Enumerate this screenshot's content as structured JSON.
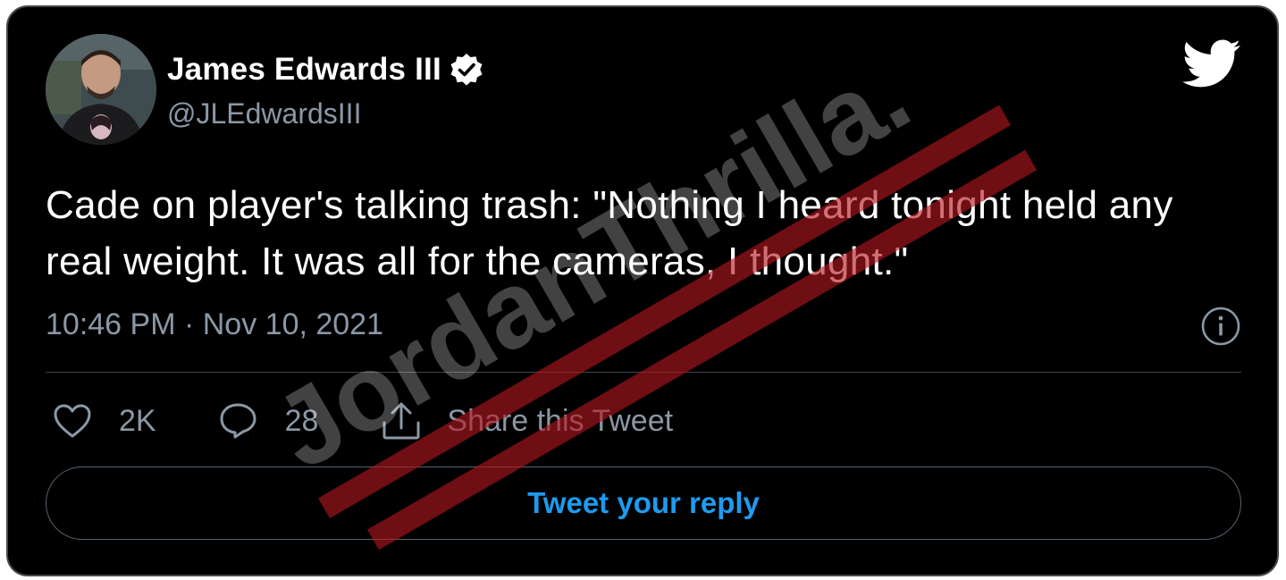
{
  "author": {
    "display_name": "James Edwards III",
    "handle": "@JLEdwardsIII",
    "verified": true,
    "avatar_icon": "profile-photo"
  },
  "tweet": {
    "text": "Cade on player's talking trash: \"Nothing I heard tonight held any real weight. It was all for the cameras, I thought.\"",
    "timestamp": "10:46 PM · Nov 10, 2021"
  },
  "actions": {
    "likes_count": "2K",
    "replies_count": "28",
    "share_label": "Share this Tweet"
  },
  "reply": {
    "label": "Tweet your reply"
  },
  "watermark": {
    "text": "JordanThrilla."
  },
  "icons": {
    "logo": "twitter-bird-icon",
    "verified": "verified-badge-icon",
    "info": "info-icon",
    "like": "heart-icon",
    "reply": "speech-bubble-icon",
    "share": "share-icon"
  },
  "colors": {
    "background": "#000000",
    "text": "#ffffff",
    "secondary_text": "#8b98a5",
    "accent": "#1d9bf0",
    "watermark_stripe": "#b3171f"
  }
}
